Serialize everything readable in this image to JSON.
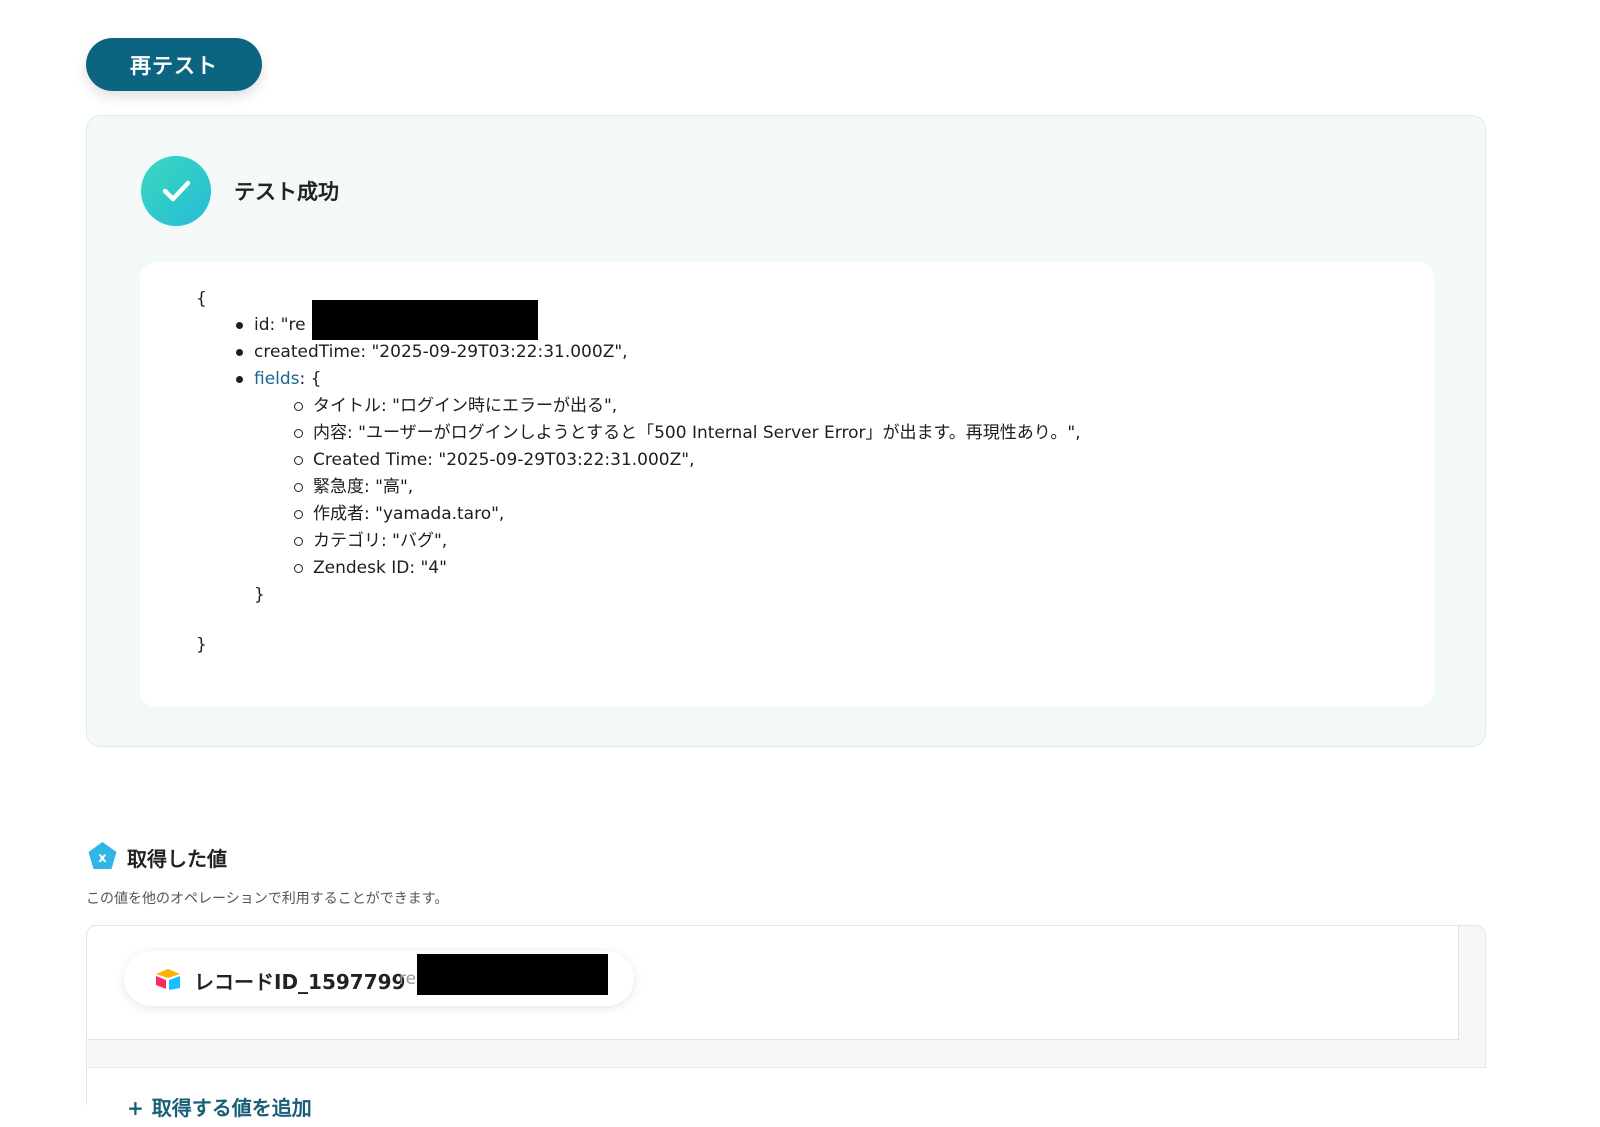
{
  "retest_button": {
    "label": "再テスト"
  },
  "result": {
    "title": "テスト成功",
    "json": {
      "open_brace": "{",
      "id_line": "id: \"re",
      "created_time_line": "createdTime: \"2025-09-29T03:22:31.000Z\",",
      "fields_key": "fields",
      "fields_open": ": {",
      "fields": [
        "タイトル: \"ログイン時にエラーが出る\",",
        "内容: \"ユーザーがログインしようとすると「500 Internal Server Error」が出ます。再現性あり。\",",
        "Created Time: \"2025-09-29T03:22:31.000Z\",",
        "緊急度: \"高\",",
        "作成者: \"yamada.taro\",",
        "カテゴリ: \"バグ\",",
        "Zendesk ID: \"4\""
      ],
      "fields_close": "}",
      "close_brace": "}"
    }
  },
  "acquired": {
    "title": "取得した値",
    "description": "この値を他のオペレーションで利用することができます。",
    "item": {
      "label": "レコードID_1597799",
      "value_prefix": "re",
      "icon": "airtable-icon"
    },
    "add_label": "取得する値を追加"
  },
  "colors": {
    "primary": "#0c6580",
    "success_gradient": [
      "#3ad8bd",
      "#25bcd8"
    ],
    "card_bg": "#f2f9f8",
    "link": "#1a6690"
  }
}
